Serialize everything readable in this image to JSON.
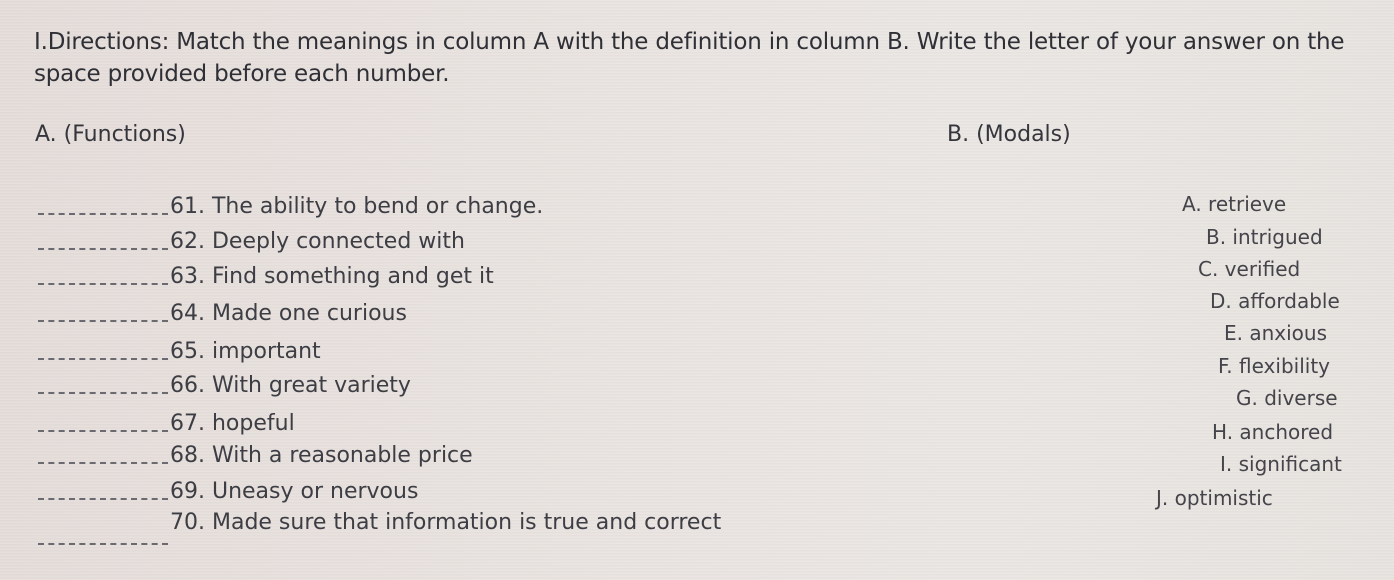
{
  "directions": "I.Directions: Match the meanings in column A with the definition in column B. Write the letter of your answer on the space provided before each number.",
  "column_a": {
    "heading": "A.   (Functions)"
  },
  "column_b": {
    "heading": "B. (Modals)"
  },
  "questions": [
    {
      "number": "61",
      "text": "61. The ability to bend or change.",
      "answer": ""
    },
    {
      "number": "62",
      "text": "62. Deeply connected with",
      "answer": ""
    },
    {
      "number": "63",
      "text": "63. Find something and get it",
      "answer": ""
    },
    {
      "number": "64",
      "text": "64. Made one curious",
      "answer": ""
    },
    {
      "number": "65",
      "text": "65. important",
      "answer": ""
    },
    {
      "number": "66",
      "text": "66. With great variety",
      "answer": ""
    },
    {
      "number": "67",
      "text": "67. hopeful",
      "answer": ""
    },
    {
      "number": "68",
      "text": "68. With a reasonable price",
      "answer": ""
    },
    {
      "number": "69",
      "text": "69. Uneasy or nervous",
      "answer": ""
    },
    {
      "number": "70",
      "text": "70. Made sure that information is true and correct",
      "answer": ""
    }
  ],
  "options": [
    {
      "letter": "A",
      "text": "A. retrieve"
    },
    {
      "letter": "B",
      "text": "B. intrigued"
    },
    {
      "letter": "C",
      "text": "C. verified"
    },
    {
      "letter": "D",
      "text": "D. affordable"
    },
    {
      "letter": "E",
      "text": "E. anxious"
    },
    {
      "letter": "F",
      "text": "F. flexibility"
    },
    {
      "letter": "G",
      "text": "G. diverse"
    },
    {
      "letter": "H",
      "text": "H. anchored"
    },
    {
      "letter": "I",
      "text": "I. significant"
    },
    {
      "letter": "J",
      "text": "J. optimistic"
    }
  ]
}
